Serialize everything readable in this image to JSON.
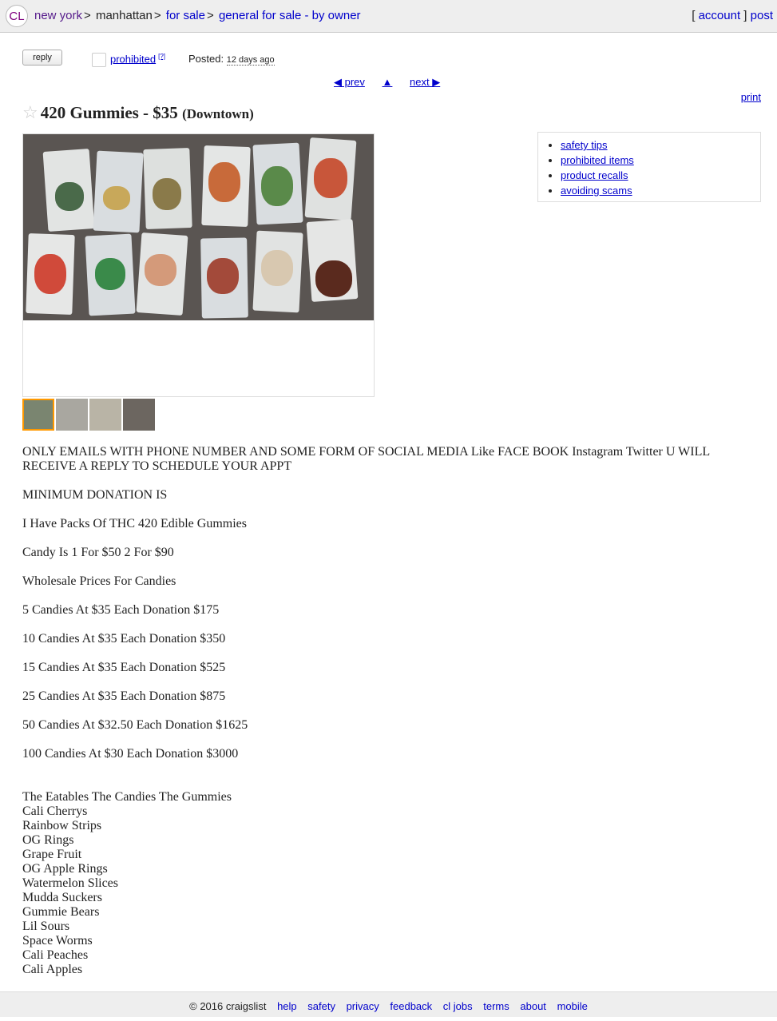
{
  "header": {
    "logo": "CL",
    "breadcrumbs": [
      "new york",
      "manhattan",
      "for sale",
      "general for sale - by owner"
    ],
    "account": "account",
    "post": "post"
  },
  "actions": {
    "reply": "reply",
    "prohibited": "prohibited",
    "prohibited_help": "[?]",
    "posted_label": "Posted:",
    "posted_time": "12 days ago",
    "prev": "◀ prev",
    "up": "▲",
    "next": "next ▶",
    "print": "print"
  },
  "title": {
    "star": "☆",
    "text": "420 Gummies - $35",
    "hood": "(Downtown)"
  },
  "sidebox": {
    "items": [
      "safety tips",
      "prohibited items",
      "product recalls",
      "avoiding scams"
    ]
  },
  "body": {
    "paragraphs": [
      "ONLY EMAILS WITH PHONE NUMBER AND SOME FORM OF SOCIAL MEDIA Like FACE BOOK Instagram Twitter U WILL RECEIVE A REPLY TO SCHEDULE YOUR APPT",
      "MINIMUM DONATION IS",
      "I Have Packs Of THC 420 Edible Gummies",
      "Candy Is 1 For $50 2 For $90",
      "Wholesale Prices For Candies",
      "5 Candies At $35 Each Donation $175",
      "10 Candies At $35 Each Donation $350",
      "15 Candies At $35 Each Donation $525",
      "25 Candies At $35 Each Donation $875",
      "50 Candies At $32.50 Each Donation $1625",
      "100 Candies At $30 Each Donation $3000"
    ],
    "list": [
      "The Eatables The Candies The Gummies",
      "Cali Cherrys",
      "Rainbow Strips",
      "OG Rings",
      "Grape Fruit",
      "OG Apple Rings",
      "Watermelon Slices",
      "Mudda Suckers",
      "Gummie Bears",
      "Lil Sours",
      "Space Worms",
      "Cali Peaches",
      "Cali Apples"
    ]
  },
  "footer": {
    "copyright": "© 2016 craigslist",
    "links": [
      "help",
      "safety",
      "privacy",
      "feedback",
      "cl jobs",
      "terms",
      "about",
      "mobile"
    ]
  },
  "colors": {
    "link": "#0000cc",
    "visited": "#551a8b",
    "accent_thumb": "#ff9900"
  }
}
